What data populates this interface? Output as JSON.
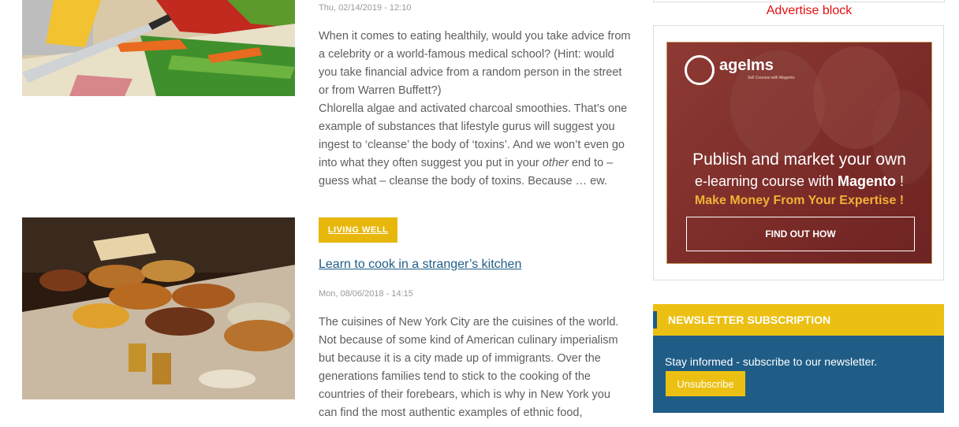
{
  "article1": {
    "date": "Thu, 02/14/2019 - 12:10",
    "paragraph1": "When it comes to eating healthily, would you take advice from a celebrity or a world-famous medical school? (Hint: would you take financial advice from a random person in the street or from Warren Buffett?)",
    "paragraph2_a": "Chlorella algae and activated charcoal smoothies. That’s one example of substances that lifestyle gurus will suggest you ingest to ‘cleanse’ the body of ‘toxins’. And we won’t even go into what they often suggest you put in your ",
    "paragraph2_em": "other",
    "paragraph2_b": " end to – guess what – cleanse the body of toxins. Because … ew."
  },
  "article2": {
    "tag": "LIVING WELL",
    "title": "Learn to cook in a stranger’s kitchen",
    "date": "Mon, 08/06/2018 - 14:15",
    "paragraph": "The cuisines of New York City are the cuisines of the world. Not because of some kind of American culinary imperialism but because it is a city made up of immigrants. Over the generations families tend to stick to the cooking of the countries of their forebears, which is why in New York you can find the most authentic examples of ethnic food,"
  },
  "sidebar": {
    "ad_label": "Advertise block",
    "ad": {
      "logo": "ageIms",
      "logo_sub": "Sell Courses with Magento",
      "line1": "Publish and market your own",
      "line2_a": "e-learning course with ",
      "line2_b": "Magento",
      "line2_c": " !",
      "line3": "Make Money From Your Expertise !",
      "button": "FIND OUT HOW"
    },
    "newsletter": {
      "heading": "NEWSLETTER SUBSCRIPTION",
      "text": "Stay informed - subscribe to our newsletter.",
      "button": "Unsubscribe"
    }
  },
  "colors": {
    "accent_yellow": "#ecc013",
    "accent_blue": "#1f5d87",
    "ad_label_red": "#e01010"
  }
}
